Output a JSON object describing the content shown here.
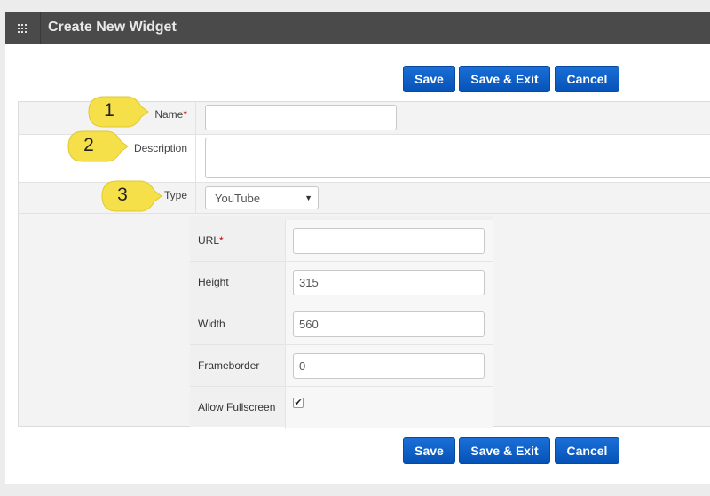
{
  "window": {
    "title": "Create New Widget",
    "menu_icon": "grid-icon"
  },
  "buttons": {
    "save": "Save",
    "save_exit": "Save & Exit",
    "cancel": "Cancel"
  },
  "form": {
    "name": {
      "label": "Name",
      "required_mark": "*",
      "value": ""
    },
    "description": {
      "label": "Description",
      "value": ""
    },
    "type": {
      "label": "Type",
      "selected": "YouTube",
      "arrow_icon": "caret-down-icon"
    }
  },
  "youtube_fields": {
    "url": {
      "label": "URL",
      "required_mark": "*",
      "value": ""
    },
    "height": {
      "label": "Height",
      "value": "315"
    },
    "width": {
      "label": "Width",
      "value": "560"
    },
    "frameborder": {
      "label": "Frameborder",
      "value": "0"
    },
    "allow_fullscreen": {
      "label": "Allow Fullscreen",
      "checked": true,
      "check_glyph": "✔"
    }
  },
  "callouts": [
    "1",
    "2",
    "3"
  ],
  "colors": {
    "button_blue": "#0a5ec8",
    "callout_yellow": "#f5e04a",
    "titlebar": "#4a4a4a",
    "required": "#cc0000"
  }
}
